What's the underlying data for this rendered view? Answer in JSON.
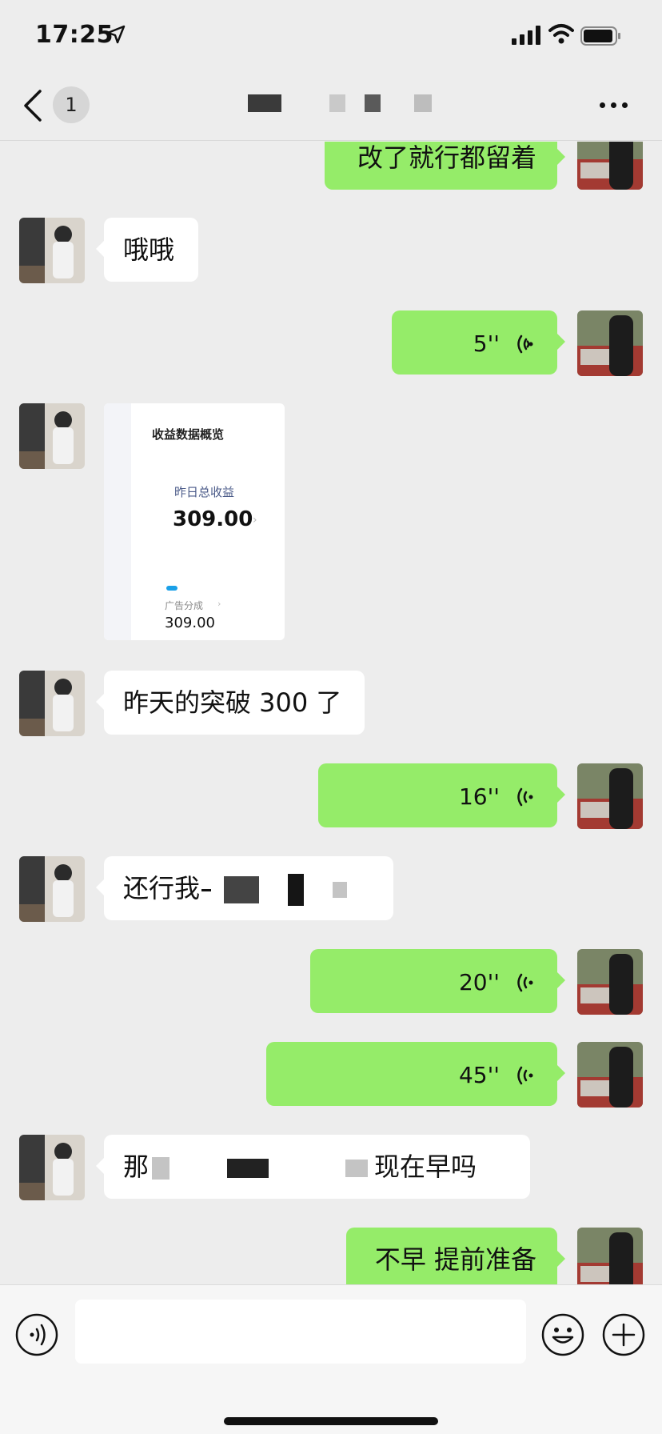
{
  "status_bar": {
    "time": "17:25"
  },
  "nav": {
    "unread_count": "1"
  },
  "messages": {
    "m1": {
      "text": "改了就行都留着"
    },
    "m2": {
      "text": "哦哦"
    },
    "m3": {
      "duration": "5''"
    },
    "m4": {
      "image": {
        "title": "收益数据概览",
        "yesterday_label": "昨日总收益",
        "yesterday_value": "309.00",
        "ad_label": "广告分成",
        "ad_value": "309.00"
      }
    },
    "m5": {
      "text": "昨天的突破 300 了"
    },
    "m6": {
      "duration": "16''"
    },
    "m7": {
      "text_start": "还行我"
    },
    "m8": {
      "duration": "20''"
    },
    "m9": {
      "duration": "45''"
    },
    "m10": {
      "text_start": "那",
      "text_end": "现在早吗"
    },
    "m11": {
      "text": "不早 提前准备"
    }
  },
  "input": {
    "placeholder": ""
  },
  "icons": {
    "back": "chevron-left-icon",
    "more": "more-horizontal-icon",
    "voice": "voice-mode-icon",
    "emoji": "emoji-icon",
    "plus": "plus-icon"
  },
  "colors": {
    "background": "#ededed",
    "outgoing_bubble": "#95ec69",
    "incoming_bubble": "#ffffff"
  }
}
